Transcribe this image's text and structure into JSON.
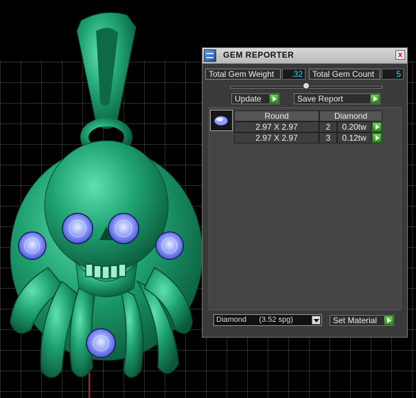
{
  "panel": {
    "title": "GEM REPORTER",
    "close_label": "x",
    "total_gem_weight_label": "Total Gem Weight",
    "total_gem_weight_value": ".32",
    "total_gem_count_label": "Total Gem Count",
    "total_gem_count_value": "5",
    "slider_level": 0.5,
    "update_label": "Update",
    "save_report_label": "Save Report",
    "table": {
      "shape_header": "Round",
      "material_header": "Diamond",
      "rows": [
        {
          "size": "2.97 X 2.97",
          "count": "2",
          "weight": "0.20tw"
        },
        {
          "size": "2.97 X 2.97",
          "count": "3",
          "weight": "0.12tw"
        }
      ]
    },
    "material_select": "Diamond      (3.52 spg)",
    "set_material_label": "Set Material"
  },
  "colors": {
    "model_green": "#1fa070",
    "gem_blue": "#6f7ef0",
    "value_cyan": "#3ad4ff",
    "panel_bg": "#3a3a3a",
    "play_green": "#4cb535"
  },
  "icons": [
    "gem-reporter-app-icon",
    "close-icon",
    "play-arrow-icon",
    "dropdown-arrow-icon",
    "round-gem-icon"
  ]
}
